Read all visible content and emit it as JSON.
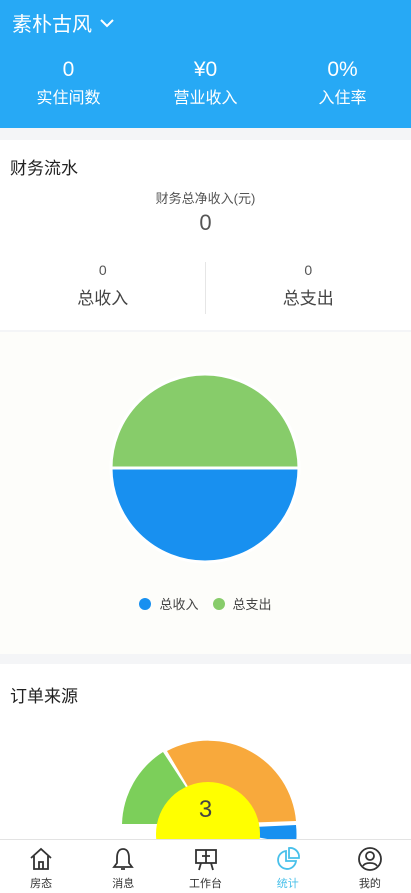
{
  "header": {
    "hotel_name": "素朴古风",
    "kpis": [
      {
        "value": "0",
        "label": "实住间数"
      },
      {
        "value": "¥0",
        "label": "营业收入"
      },
      {
        "value": "0%",
        "label": "入住率"
      }
    ]
  },
  "finance": {
    "title": "财务流水",
    "net_label": "财务总净收入(元)",
    "net_value": "0",
    "income": {
      "value": "0",
      "label": "总收入"
    },
    "expense": {
      "value": "0",
      "label": "总支出"
    }
  },
  "chart_data": {
    "type": "pie",
    "series": [
      {
        "name": "总收入",
        "value": 1,
        "color": "#1890f0"
      },
      {
        "name": "总支出",
        "value": 1,
        "color": "#87cc6a"
      }
    ],
    "legend": "bottom"
  },
  "orders": {
    "title": "订单来源",
    "center_value": "3",
    "colors": {
      "orange": "#f8a93c",
      "green": "#7ccf5a",
      "blue": "#1890f0",
      "center": "#ffff00"
    }
  },
  "tabbar": {
    "active_color": "#48c0ea",
    "items": [
      {
        "label": "房态",
        "icon": "house-icon"
      },
      {
        "label": "消息",
        "icon": "bell-icon"
      },
      {
        "label": "工作台",
        "icon": "board-icon"
      },
      {
        "label": "统计",
        "icon": "pie-chart-icon",
        "active": true
      },
      {
        "label": "我的",
        "icon": "user-icon"
      }
    ]
  }
}
